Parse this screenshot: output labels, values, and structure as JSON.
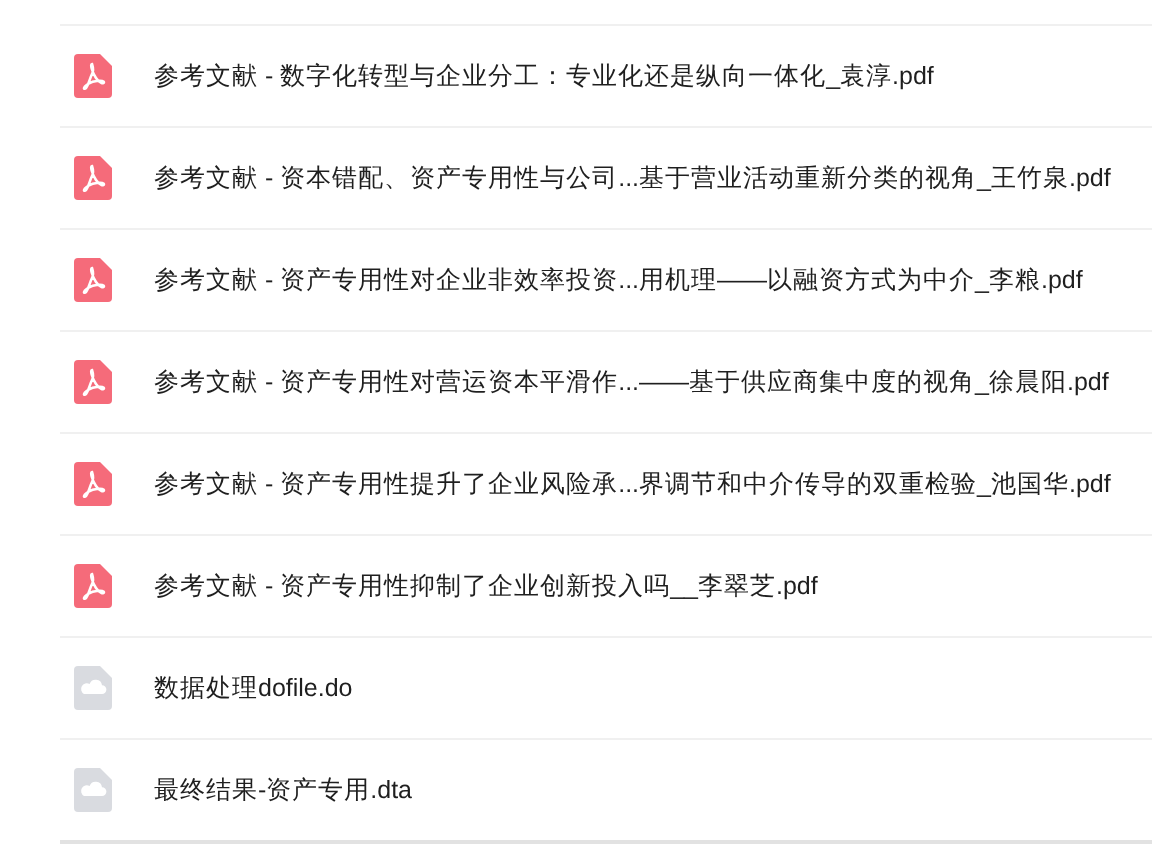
{
  "files": [
    {
      "kind": "pdf",
      "name": "参考文献 - 数字化转型与企业分工：专业化还是纵向一体化_袁淳.pdf"
    },
    {
      "kind": "pdf",
      "name": "参考文献 - 资本错配、资产专用性与公司...基于营业活动重新分类的视角_王竹泉.pdf"
    },
    {
      "kind": "pdf",
      "name": "参考文献 - 资产专用性对企业非效率投资...用机理——以融资方式为中介_李粮.pdf"
    },
    {
      "kind": "pdf",
      "name": "参考文献 - 资产专用性对营运资本平滑作...——基于供应商集中度的视角_徐晨阳.pdf"
    },
    {
      "kind": "pdf",
      "name": "参考文献 - 资产专用性提升了企业风险承...界调节和中介传导的双重检验_池国华.pdf"
    },
    {
      "kind": "pdf",
      "name": "参考文献 - 资产专用性抑制了企业创新投入吗__李翠芝.pdf"
    },
    {
      "kind": "file",
      "name": "数据处理dofile.do"
    },
    {
      "kind": "file",
      "name": "最终结果-资产专用.dta"
    }
  ]
}
